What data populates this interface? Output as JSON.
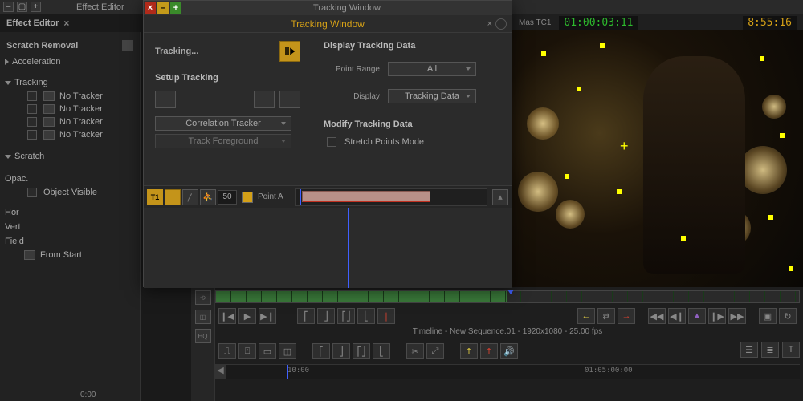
{
  "topbar": {
    "title": "Effect Editor"
  },
  "effect_editor": {
    "tab_label": "Effect Editor",
    "header": "Scratch Removal",
    "groups": {
      "acceleration": "Acceleration",
      "tracking": "Tracking",
      "scratch": "Scratch",
      "opac": "Opac.",
      "object_visible": "Object Visible",
      "hor": "Hor",
      "vert": "Vert",
      "field": "Field",
      "from_start": "From Start"
    },
    "tracker_items": [
      "No Tracker",
      "No Tracker",
      "No Tracker",
      "No Tracker"
    ],
    "bottom_tc": "0:00"
  },
  "viewer": {
    "label": "Mas TC1",
    "tc_green": "01:00:03:11",
    "tc_amber": "8:55:16"
  },
  "tracking_window": {
    "outer_title": "Tracking Window",
    "title": "Tracking Window",
    "status": "Tracking...",
    "setup_heading": "Setup Tracking",
    "tracker_type": "Correlation Tracker",
    "track_target": "Track Foreground",
    "display_heading": "Display Tracking Data",
    "point_range_label": "Point Range",
    "point_range_value": "All",
    "display_label": "Display",
    "display_value": "Tracking Data",
    "modify_heading": "Modify Tracking Data",
    "stretch_label": "Stretch Points Mode",
    "track_row": {
      "t1": "T1",
      "num": "50",
      "point": "Point A"
    }
  },
  "timeline": {
    "hq": "HQ",
    "info": "Timeline - New Sequence.01 - 1920x1080 - 25.00 fps",
    "tc_left": "10:00",
    "tc_right": "01:05:00:00"
  }
}
